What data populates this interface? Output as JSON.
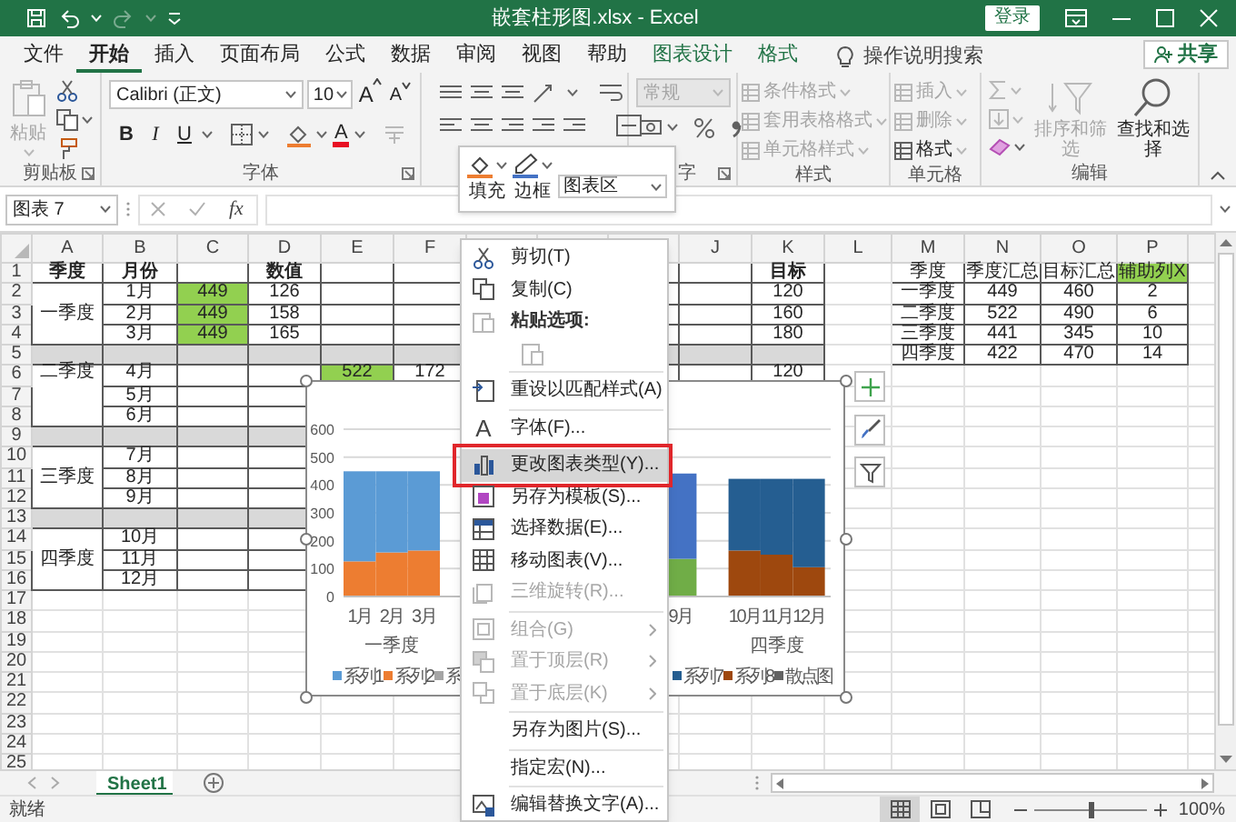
{
  "title_bar": {
    "title": "嵌套柱形图.xlsx  -  Excel",
    "sign_in": "登录",
    "redo_disabled": true
  },
  "tabs": [
    {
      "label": "文件",
      "selected": false,
      "contextual": false
    },
    {
      "label": "开始",
      "selected": true,
      "contextual": false
    },
    {
      "label": "插入",
      "selected": false,
      "contextual": false
    },
    {
      "label": "页面布局",
      "selected": false,
      "contextual": false
    },
    {
      "label": "公式",
      "selected": false,
      "contextual": false
    },
    {
      "label": "数据",
      "selected": false,
      "contextual": false
    },
    {
      "label": "审阅",
      "selected": false,
      "contextual": false
    },
    {
      "label": "视图",
      "selected": false,
      "contextual": false
    },
    {
      "label": "帮助",
      "selected": false,
      "contextual": false
    },
    {
      "label": "图表设计",
      "selected": false,
      "contextual": true
    },
    {
      "label": "格式",
      "selected": false,
      "contextual": true
    }
  ],
  "tell_me": "操作说明搜索",
  "share": "共享",
  "ribbon_groups": [
    {
      "kind": "clipboard",
      "label": "剪贴板",
      "paste": {
        "label": "粘贴",
        "disabled": true
      }
    },
    {
      "kind": "font",
      "label": "字体",
      "font_name": "Calibri (正文)",
      "font_size": "10",
      "grow": "A",
      "shrink": "A",
      "styles": [
        "B",
        "I",
        "U"
      ],
      "font_color": "A"
    },
    {
      "kind": "alignment"
    },
    {
      "kind": "number",
      "label": "字",
      "format": {
        "label": "常规",
        "disabled": true
      }
    },
    {
      "kind": "styles",
      "label": "样式",
      "buttons": [
        {
          "label": "条件格式",
          "disabled": true
        },
        {
          "label": "套用表格格式",
          "disabled": true
        },
        {
          "label": "单元格样式",
          "disabled": true
        }
      ]
    },
    {
      "kind": "cells",
      "label": "单元格",
      "buttons": [
        {
          "label": "插入",
          "disabled": true
        },
        {
          "label": "删除",
          "disabled": true
        },
        {
          "label": "格式",
          "disabled": false
        }
      ]
    },
    {
      "kind": "editing",
      "label": "编辑",
      "buttons": [
        {
          "label": "排序和筛选",
          "disabled": true
        },
        {
          "label": "查找和选择",
          "disabled": false
        }
      ]
    }
  ],
  "mini_toolbar": {
    "fill": "填充",
    "outline": "边框",
    "element": "图表区"
  },
  "formula_bar": {
    "name_box": "图表 7",
    "function_symbol": "fx"
  },
  "sheet": {
    "columns": [
      "A",
      "B",
      "C",
      "D",
      "E",
      "F",
      null,
      null,
      null,
      "J",
      "K",
      "L",
      "M",
      "N",
      "O",
      "P"
    ],
    "rows": [
      "1",
      "2",
      "3",
      "4",
      "5",
      "6",
      "7",
      "8",
      "9",
      "10",
      "11",
      "12",
      "13",
      "14",
      "15",
      "16",
      "17",
      "18",
      "19",
      "20",
      "21",
      "22",
      "23",
      "24",
      "25"
    ],
    "data_table": {
      "header": {
        "quarter": "季度",
        "month": "月份",
        "value": "数值",
        "target": "目标"
      },
      "groups": [
        {
          "quarter": "一季度",
          "rows": [
            {
              "month": "1月",
              "column_c": {
                "text": "449",
                "highlighted": true
              },
              "value": "126",
              "target": "120"
            },
            {
              "month": "2月",
              "column_c": {
                "text": "449",
                "highlighted": true
              },
              "value": "158",
              "target": "160"
            },
            {
              "month": "3月",
              "column_c": {
                "text": "449",
                "highlighted": true
              },
              "value": "165",
              "target": "180"
            }
          ]
        },
        {
          "quarter": "二季度",
          "rows": [
            {
              "month": "4月",
              "column_e": {
                "text": "522",
                "highlighted": true
              },
              "column_f": "172",
              "target": "120"
            },
            {
              "month": "5月"
            },
            {
              "month": "6月"
            }
          ]
        },
        {
          "quarter": "三季度",
          "rows": [
            {
              "month": "7月"
            },
            {
              "month": "8月"
            },
            {
              "month": "9月"
            }
          ]
        },
        {
          "quarter": "四季度",
          "rows": [
            {
              "month": "10月"
            },
            {
              "month": "11月"
            },
            {
              "month": "12月"
            }
          ]
        }
      ]
    },
    "summary_table": {
      "columns": [
        {
          "label": "季度",
          "highlighted": false
        },
        {
          "label": "季度汇总",
          "highlighted": false
        },
        {
          "label": "目标汇总",
          "highlighted": false
        },
        {
          "label": "辅助列X",
          "highlighted": true
        }
      ],
      "rows": [
        [
          "一季度",
          "449",
          "460",
          "2"
        ],
        [
          "二季度",
          "522",
          "490",
          "6"
        ],
        [
          "三季度",
          "441",
          "345",
          "10"
        ],
        [
          "四季度",
          "422",
          "470",
          "14"
        ]
      ]
    }
  },
  "chart": {
    "selected": true,
    "chart_data": {
      "type": "bar",
      "categories": [
        "1月",
        "2月",
        "3月",
        null,
        null,
        null,
        null,
        null,
        "9月",
        "10月",
        "11月",
        "12月"
      ],
      "ylim": [
        0,
        600
      ],
      "yticks": [
        0,
        100,
        200,
        300,
        400,
        500,
        600
      ],
      "stacked": true,
      "grid": true,
      "legend": "bottom",
      "series": [
        {
          "name": "系列2",
          "color": "#ed7d31",
          "values": [
            126,
            158,
            165,
            null,
            null,
            null,
            null,
            null,
            null,
            null,
            null,
            null
          ]
        },
        {
          "name": "系列1",
          "color": "#5b9bd5",
          "values": [
            323,
            291,
            284,
            null,
            null,
            null,
            null,
            null,
            null,
            null,
            null,
            null
          ]
        },
        {
          "name": "系",
          "color": "#a5a5a5",
          "values": [
            null,
            null,
            null,
            null,
            null,
            null,
            null,
            null,
            null,
            null,
            null,
            null
          ]
        },
        {
          "color": "#70ad47",
          "values": [
            null,
            null,
            null,
            null,
            null,
            null,
            null,
            null,
            135,
            null,
            null,
            null
          ]
        },
        {
          "color": "#4472c4",
          "values": [
            null,
            null,
            null,
            null,
            null,
            null,
            null,
            null,
            306,
            null,
            null,
            null
          ]
        },
        {
          "name": "系列8",
          "color": "#9e480e",
          "values": [
            null,
            null,
            null,
            null,
            null,
            null,
            null,
            null,
            null,
            165,
            150,
            105
          ]
        },
        {
          "name": "系列7",
          "color": "#255e91",
          "values": [
            null,
            null,
            null,
            null,
            null,
            null,
            null,
            null,
            null,
            257,
            272,
            317
          ]
        },
        {
          "name": "散点图",
          "color": "#636363",
          "values": [
            null,
            null,
            null,
            null,
            null,
            null,
            null,
            null,
            null,
            null,
            null,
            null
          ]
        }
      ]
    },
    "groups": [
      "一季度",
      "四季度"
    ]
  },
  "context_menu": [
    {
      "kind": "command",
      "label": "剪切(T)",
      "disabled": false,
      "selected": false,
      "submenu": false,
      "callout": false
    },
    {
      "kind": "command",
      "label": "复制(C)",
      "disabled": false,
      "selected": false,
      "submenu": false,
      "callout": false
    },
    {
      "kind": "heading",
      "label": "粘贴选项:"
    },
    {
      "kind": "paste_options"
    },
    {
      "kind": "separator"
    },
    {
      "kind": "command",
      "label": "重设以匹配样式(A)",
      "disabled": false,
      "selected": false,
      "submenu": false,
      "callout": false
    },
    {
      "kind": "separator"
    },
    {
      "kind": "command",
      "label": "字体(F)...",
      "glyph": "A",
      "disabled": false,
      "selected": false,
      "submenu": false,
      "callout": false
    },
    {
      "kind": "separator"
    },
    {
      "kind": "command",
      "label": "更改图表类型(Y)...",
      "disabled": false,
      "selected": true,
      "submenu": false,
      "callout": true
    },
    {
      "kind": "command",
      "label": "另存为模板(S)...",
      "disabled": false,
      "selected": false,
      "submenu": false,
      "callout": false
    },
    {
      "kind": "command",
      "label": "选择数据(E)...",
      "disabled": false,
      "selected": false,
      "submenu": false,
      "callout": false
    },
    {
      "kind": "command",
      "label": "移动图表(V)...",
      "disabled": false,
      "selected": false,
      "submenu": false,
      "callout": false
    },
    {
      "kind": "command",
      "label": "三维旋转(R)...",
      "disabled": true,
      "selected": false,
      "submenu": false,
      "callout": false
    },
    {
      "kind": "separator"
    },
    {
      "kind": "command",
      "label": "组合(G)",
      "disabled": true,
      "selected": false,
      "submenu": true,
      "callout": false
    },
    {
      "kind": "command",
      "label": "置于顶层(R)",
      "disabled": true,
      "selected": false,
      "submenu": true,
      "callout": false
    },
    {
      "kind": "command",
      "label": "置于底层(K)",
      "disabled": true,
      "selected": false,
      "submenu": true,
      "callout": false
    },
    {
      "kind": "separator"
    },
    {
      "kind": "command",
      "label": "另存为图片(S)...",
      "disabled": false,
      "selected": false,
      "submenu": false,
      "callout": false
    },
    {
      "kind": "separator"
    },
    {
      "kind": "command",
      "label": "指定宏(N)...",
      "disabled": false,
      "selected": false,
      "submenu": false,
      "callout": false
    },
    {
      "kind": "separator"
    },
    {
      "kind": "command",
      "label": "编辑替换文字(A)...",
      "disabled": false,
      "selected": false,
      "submenu": false,
      "callout": false
    }
  ],
  "sheet_tabs": [
    {
      "label": "Sheet1",
      "selected": true
    }
  ],
  "status_bar": {
    "status": "就绪",
    "views": [
      {
        "selected": true
      },
      {
        "selected": false
      },
      {
        "selected": false
      }
    ],
    "zoom": {
      "level": 0.5,
      "reading": "100%"
    }
  }
}
